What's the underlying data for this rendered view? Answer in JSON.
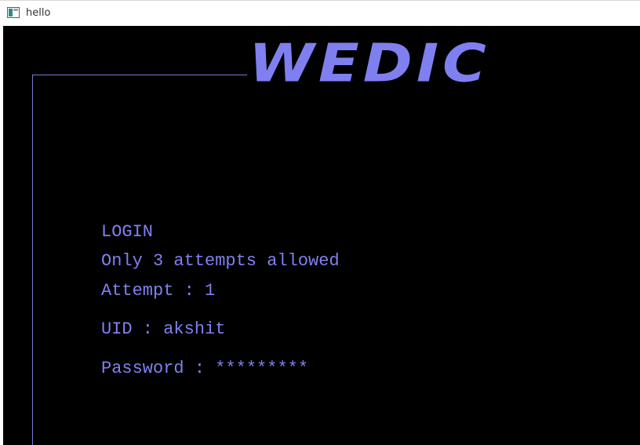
{
  "window": {
    "title": "hello",
    "icon": "console-window-icon"
  },
  "colors": {
    "background": "#000000",
    "text": "#8080f0",
    "banner": "#7f7ff0",
    "border": "#7a7ad6"
  },
  "banner": {
    "text": "WEDIC"
  },
  "login": {
    "heading": "LOGIN",
    "attempts_note": "Only 3 attempts allowed",
    "attempt_label": "Attempt : 1",
    "uid_label": "UID : ",
    "uid_value": "akshit",
    "password_label": "Password : ",
    "password_value": "*********"
  }
}
